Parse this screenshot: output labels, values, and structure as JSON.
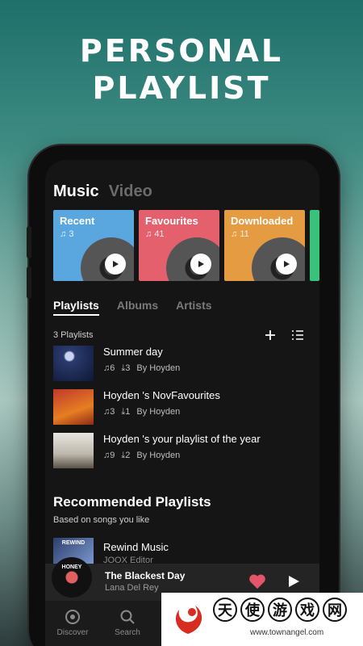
{
  "headline": {
    "line1": "PERSONAL",
    "line2": "PLAYLIST"
  },
  "top_tabs": [
    {
      "label": "Music",
      "active": true
    },
    {
      "label": "Video",
      "active": false
    }
  ],
  "cards": [
    {
      "title": "Recent",
      "count": "3",
      "color": "#5aa7df"
    },
    {
      "title": "Favourites",
      "count": "41",
      "color": "#e4606d"
    },
    {
      "title": "Downloaded",
      "count": "11",
      "color": "#e59b42"
    }
  ],
  "sub_tabs": [
    {
      "label": "Playlists",
      "active": true
    },
    {
      "label": "Albums"
    },
    {
      "label": "Artists"
    }
  ],
  "playlists_count_label": "3 Playlists",
  "playlists": [
    {
      "title": "Summer day",
      "songs": "6",
      "downloads": "3",
      "owner": "By Hoyden"
    },
    {
      "title": "Hoyden 's NovFavourites",
      "songs": "3",
      "downloads": "1",
      "owner": "By Hoyden"
    },
    {
      "title": "Hoyden 's your playlist of the year",
      "songs": "9",
      "downloads": "2",
      "owner": "By Hoyden"
    }
  ],
  "recommended": {
    "title": "Recommended Playlists",
    "subtitle": "Based on songs you like",
    "items": [
      {
        "name": "Rewind Music",
        "editor": "JOOX Editor",
        "thumb_text": "REWIND"
      }
    ]
  },
  "player": {
    "song": "The Blackest Day",
    "artist": "Lana Del Rey",
    "disc_text": "HONEY"
  },
  "bottom_nav": [
    {
      "label": "Discover"
    },
    {
      "label": "Search"
    }
  ],
  "watermark": {
    "chars": [
      "天",
      "使",
      "游",
      "戏",
      "网"
    ],
    "url": "www.townangel.com"
  },
  "colors": {
    "accent_heart": "#e2566a",
    "screen_bg": "#151515"
  }
}
